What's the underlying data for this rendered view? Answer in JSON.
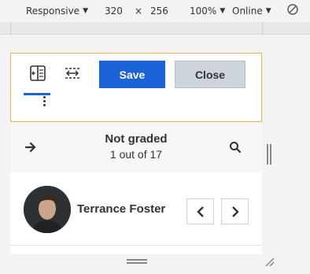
{
  "devtools": {
    "device": "Responsive",
    "width": "320",
    "times": "×",
    "height": "256",
    "zoom": "100%",
    "network": "Online"
  },
  "toolbar": {
    "save_label": "Save",
    "close_label": "Close"
  },
  "grading": {
    "status": "Not graded",
    "count": "1 out of 17"
  },
  "student": {
    "name": "Terrance Foster"
  },
  "colors": {
    "accent": "#1a63d6",
    "focus_border": "#f1b34b"
  }
}
